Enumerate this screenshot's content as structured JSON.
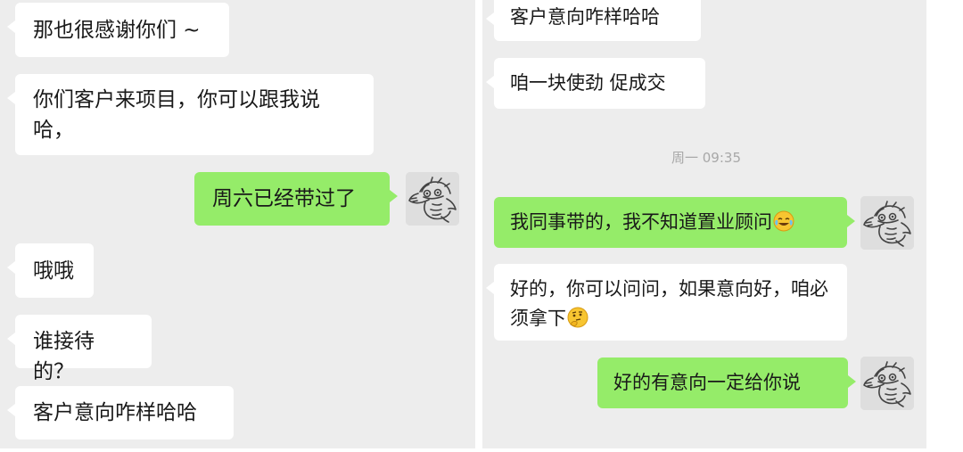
{
  "left_chat": {
    "messages": [
      {
        "side": "in",
        "text": "那也很感谢你们 ~"
      },
      {
        "side": "in",
        "text": "你们客户来项目，你可以跟我说哈，"
      },
      {
        "side": "out",
        "text": "周六已经带过了"
      },
      {
        "side": "in",
        "text": "哦哦"
      },
      {
        "side": "in",
        "text": "谁接待的？"
      },
      {
        "side": "in",
        "text": "客户意向咋样哈哈"
      }
    ]
  },
  "right_chat": {
    "timestamp": "周一 09:35",
    "messages": [
      {
        "side": "in",
        "text": "客户意向咋样哈哈"
      },
      {
        "side": "in",
        "text": "咱一块使劲 促成交"
      },
      {
        "side": "out",
        "text": "我同事带的，我不知道置业顾问",
        "emoji": "laughing-crying-emoji"
      },
      {
        "side": "in",
        "text": "好的，你可以问问，如果意向好，咱必须拿下",
        "emoji": "thinking-emoji"
      },
      {
        "side": "out",
        "text": "好的有意向一定给你说"
      }
    ]
  },
  "avatar": {
    "icon": "dragon-sketch-avatar"
  },
  "colors": {
    "chat_background": "#ededed",
    "incoming_bubble": "#ffffff",
    "outgoing_bubble": "#95ec69",
    "timestamp_text": "#a8a8a8"
  }
}
